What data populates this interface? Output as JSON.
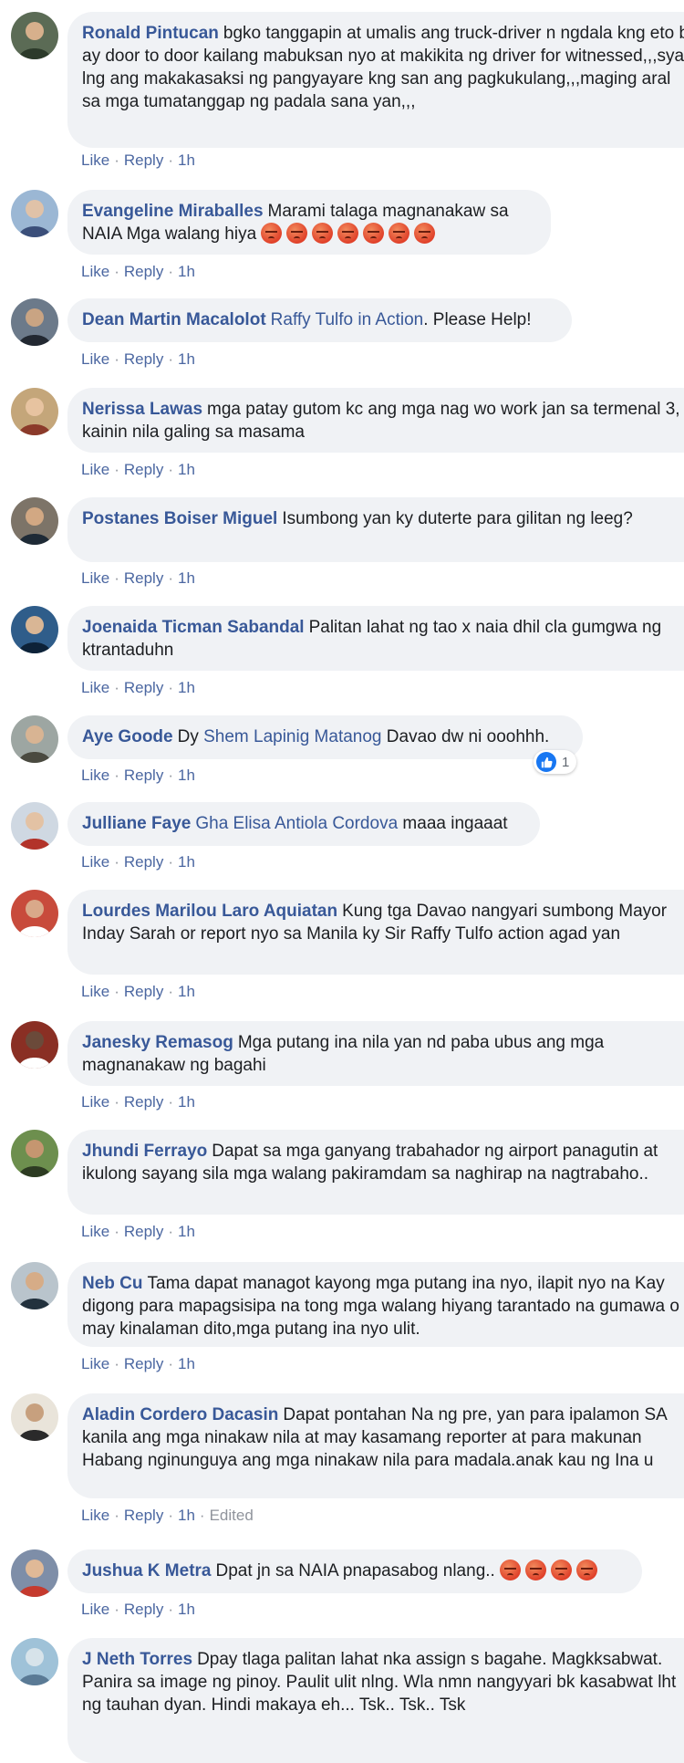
{
  "actions": {
    "like": "Like",
    "reply": "Reply",
    "sep": "·"
  },
  "comments": [
    {
      "author": "Ronald Pintucan",
      "text": "bgko tanggapin at umalis ang truck-driver n ngdala kng eto b ay door to door kailang mabuksan nyo at makikita ng driver for witnessed,,,sya lng ang makakasaksi ng pangyayare kng san ang pagkukulang,,,maging aral sa mga tumatanggap ng padala sana yan,,,",
      "time": "1h"
    },
    {
      "author": "Evangeline Miraballes",
      "text": "Marami talaga magnanakaw sa NAIA Mga walang hiya",
      "emoji_count": 7,
      "time": "1h"
    },
    {
      "author": "Dean Martin Macalolot",
      "mention": "Raffy Tulfo in Action",
      "text": ". Please Help!",
      "time": "1h"
    },
    {
      "author": "Nerissa Lawas",
      "text": "mga patay gutom kc ang mga nag wo work jan sa termenal 3, kainin nila galing sa masama",
      "time": "1h"
    },
    {
      "author": "Postanes Boiser Miguel",
      "text": "Isumbong yan ky duterte para gilitan ng leeg?",
      "time": "1h"
    },
    {
      "author": "Joenaida Ticman Sabandal",
      "text": "Palitan lahat ng tao x naia dhil cla gumgwa ng ktrantaduhn",
      "time": "1h"
    },
    {
      "author": "Aye Goode",
      "prefix": "Dy ",
      "mention": "Shem Lapinig Matanog",
      "text": " Davao dw ni ooohhh.",
      "time": "1h",
      "reaction_count": "1"
    },
    {
      "author": "Julliane Faye",
      "mention": "Gha Elisa Antiola Cordova",
      "text": " maaa ingaaat",
      "time": "1h"
    },
    {
      "author": "Lourdes Marilou Laro Aquiatan",
      "text": "Kung tga Davao nangyari sumbong Mayor Inday Sarah or report nyo sa Manila ky Sir Raffy Tulfo action agad yan",
      "time": "1h"
    },
    {
      "author": "Janesky Remasog",
      "text": "Mga putang ina nila yan nd paba ubus ang mga magnanakaw ng bagahi",
      "time": "1h"
    },
    {
      "author": "Jhundi Ferrayo",
      "text": "Dapat sa mga ganyang trabahador ng airport panagutin at ikulong sayang sila mga walang pakiramdam sa naghirap na nagtrabaho..",
      "time": "1h"
    },
    {
      "author": "Neb Cu",
      "text": "Tama dapat managot kayong mga putang ina nyo, ilapit nyo na Kay digong para mapagsisipa na tong mga walang hiyang tarantado na gumawa o may kinalaman dito,mga putang ina nyo ulit.",
      "time": "1h"
    },
    {
      "author": "Aladin Cordero Dacasin",
      "text": "Dapat pontahan Na ng pre, yan para ipalamon SA kanila ang mga ninakaw nila at may kasamang reporter at para makunan Habang nginunguya ang mga ninakaw nila para madala.anak kau ng Ina u",
      "time": "1h",
      "edited": "Edited"
    },
    {
      "author": "Jushua K Metra",
      "text": "Dpat jn sa NAIA pnapasabog nlang..",
      "emoji_count": 4,
      "time": "1h"
    },
    {
      "author": "J Neth Torres",
      "text": "Dpay tlaga palitan lahat nka assign s bagahe. Magkksabwat. Panira sa image ng pinoy. Paulit ulit nlng. Wla nmn nangyyari bk kasabwat lht ng tauhan dyan. Hindi makaya eh... Tsk.. Tsk.. Tsk"
    }
  ],
  "colors": {
    "name": "#385898",
    "bubble": "#f0f2f5",
    "action": "#4b67a1",
    "meta": "#90949c",
    "like_blue": "#1877f2"
  }
}
